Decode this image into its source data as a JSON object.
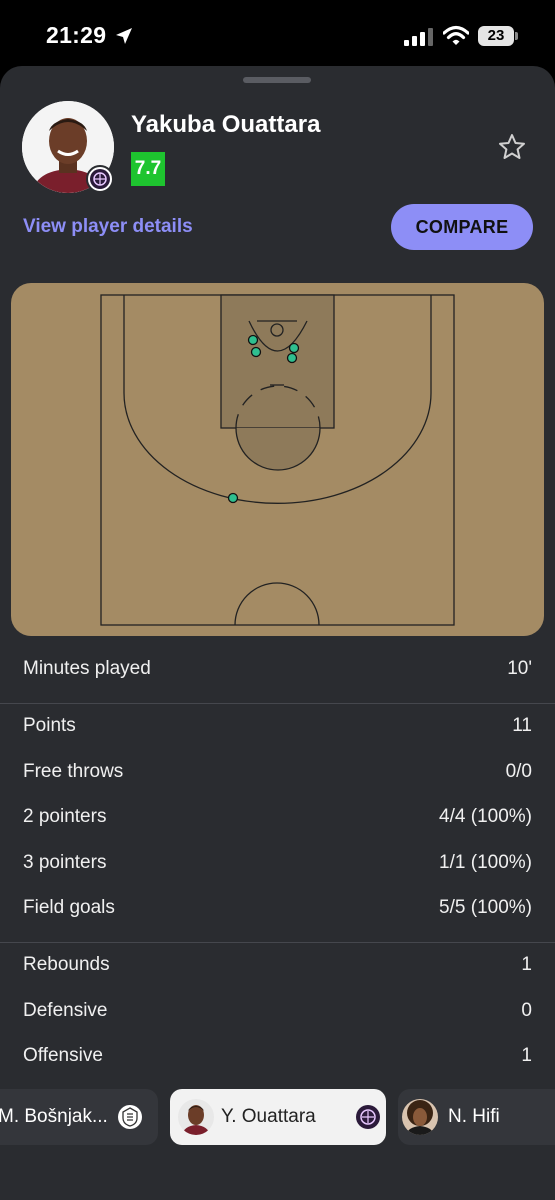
{
  "status_bar": {
    "time": "21:29",
    "battery": "23"
  },
  "player": {
    "name": "Yakuba Ouattara",
    "rating": "7.7",
    "rating_color": "#1ec42f",
    "view_details": "View player details",
    "compare_label": "COMPARE"
  },
  "shot_chart": {
    "made_shots": 5,
    "court_color": "#a48b64",
    "marker_color": "#2fbf8f"
  },
  "stats": {
    "minutes": {
      "label": "Minutes played",
      "value": "10'"
    },
    "points": {
      "label": "Points",
      "value": "11"
    },
    "free_throws": {
      "label": "Free throws",
      "value": "0/0"
    },
    "two_pointers": {
      "label": "2 pointers",
      "value": "4/4 (100%)"
    },
    "three_pointers": {
      "label": "3 pointers",
      "value": "1/1 (100%)"
    },
    "field_goals": {
      "label": "Field goals",
      "value": "5/5 (100%)"
    },
    "rebounds": {
      "label": "Rebounds",
      "value": "1"
    },
    "defensive": {
      "label": "Defensive",
      "value": "0"
    },
    "offensive": {
      "label": "Offensive",
      "value": "1"
    }
  },
  "player_switcher": [
    {
      "name": "M. Bošnjak...",
      "active": false
    },
    {
      "name": "Y. Ouattara",
      "active": true
    },
    {
      "name": "N. Hifi",
      "active": false
    }
  ],
  "accent_color": "#8d8ef6"
}
